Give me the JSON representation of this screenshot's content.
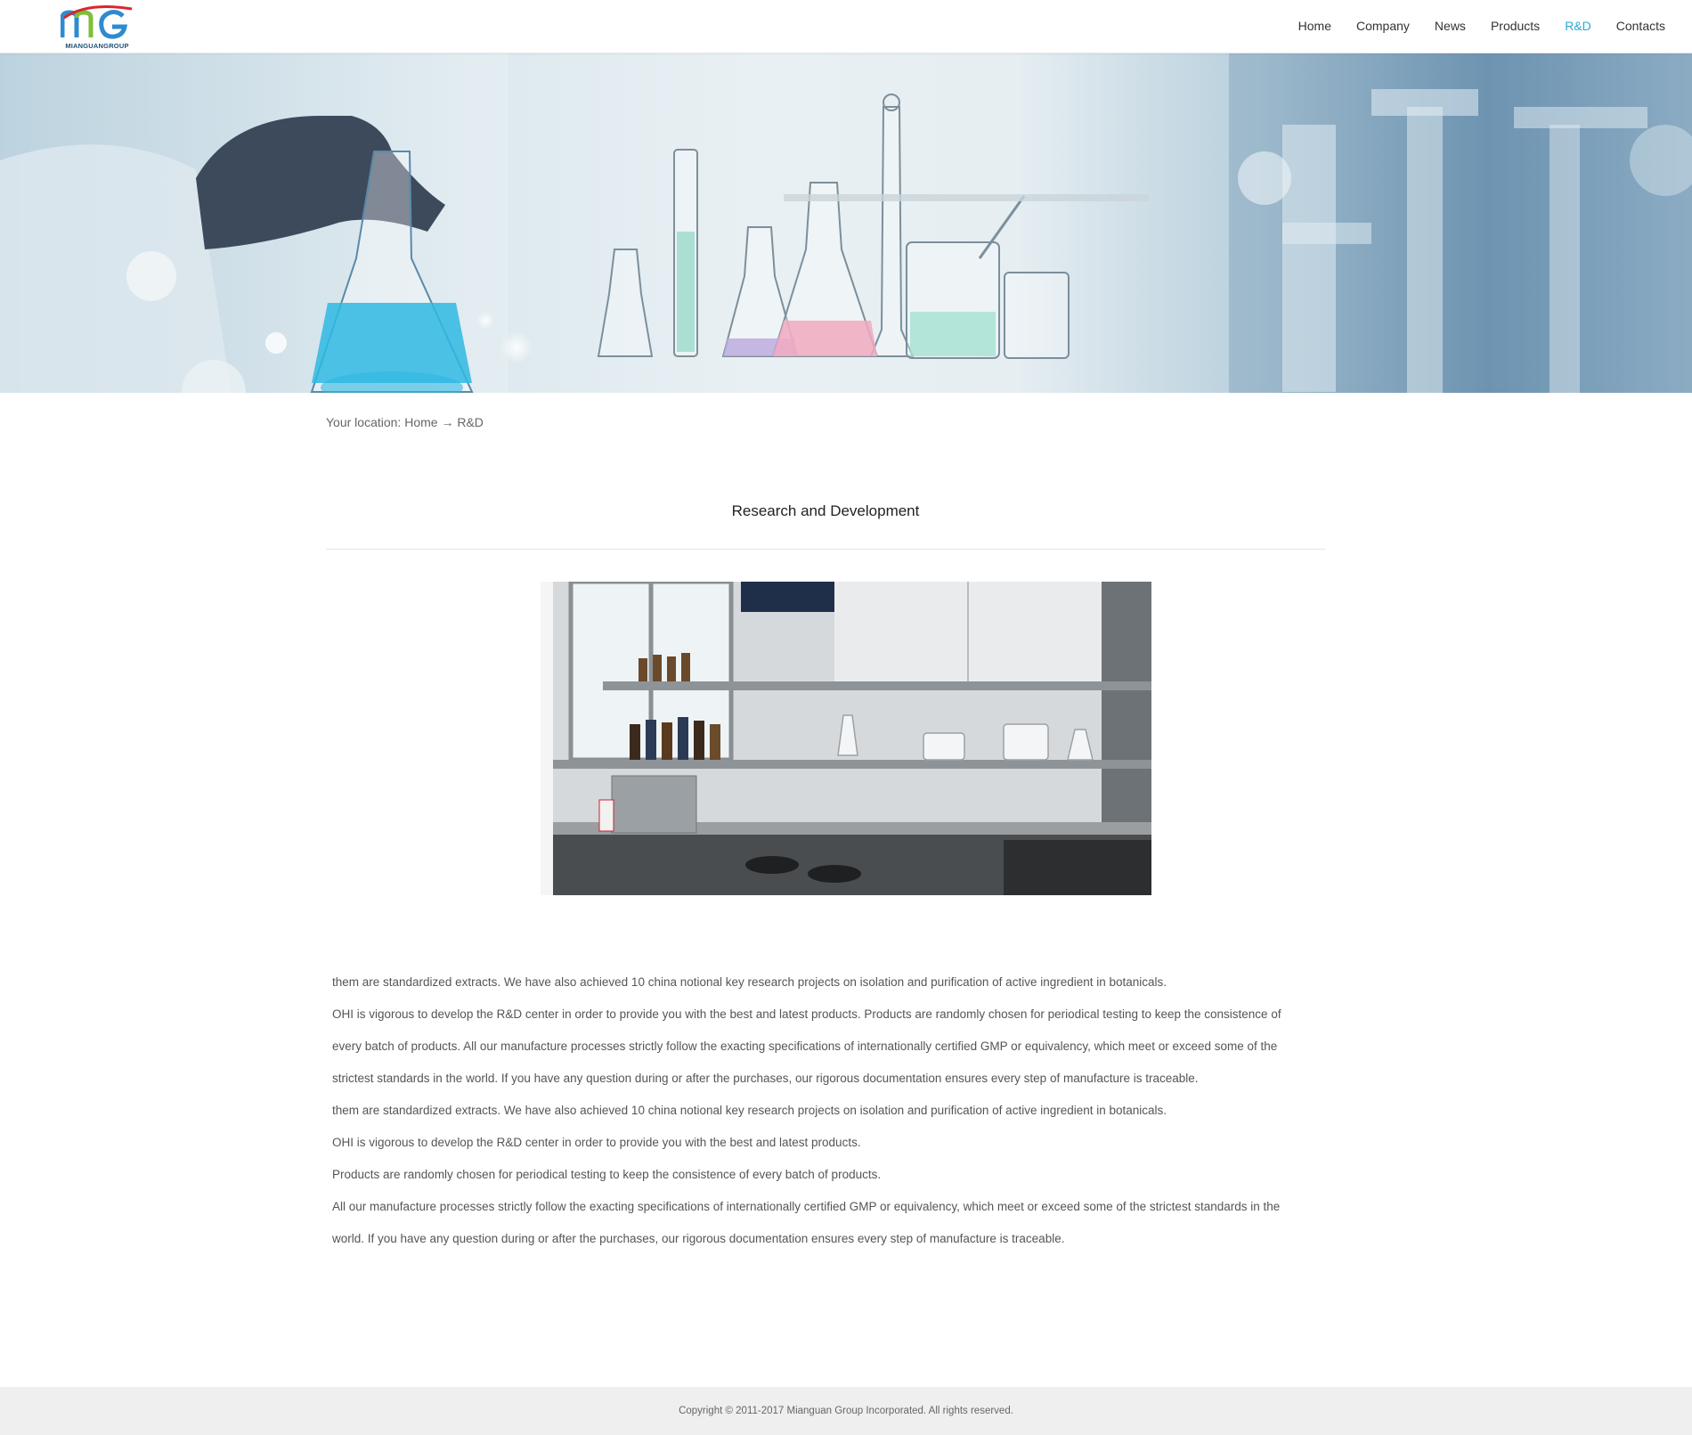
{
  "header": {
    "logo_text": "MIANGUANGROUP",
    "nav": [
      {
        "label": "Home"
      },
      {
        "label": "Company"
      },
      {
        "label": "News"
      },
      {
        "label": "Products"
      },
      {
        "label": "R&D",
        "active": true
      },
      {
        "label": "Contacts"
      }
    ],
    "active_color": "#2ea7d6"
  },
  "breadcrumb": {
    "prefix": "Your location:",
    "home": "Home",
    "separator": "→",
    "current": "R&D"
  },
  "main": {
    "title": "Research and Development",
    "paragraphs": [
      "them are standardized extracts. We have also achieved 10 china notional key research projects on isolation and purification of active ingredient in botanicals.",
      "OHI is vigorous to develop the R&D center in order to provide you with the best and latest products. Products are randomly chosen for periodical testing to keep the consistence of",
      "every batch of products. All our manufacture processes strictly follow the exacting specifications of internationally certified GMP or equivalency, which meet or exceed some of the",
      "strictest standards in the world. If you have any question during or after the purchases, our rigorous documentation ensures every step of manufacture is traceable.",
      "them are standardized extracts. We have also achieved 10 china notional key research projects on isolation and purification of active ingredient in botanicals.",
      "OHI is vigorous to develop the R&D center in order to provide you with the best and latest products.",
      "Products are randomly chosen for periodical testing to keep the consistence of every batch of products.",
      " All our manufacture processes strictly follow the exacting specifications of internationally certified GMP or equivalency, which meet or exceed some of the strictest standards in the",
      "world. If you have any question during or after the purchases, our rigorous documentation ensures every step of manufacture is traceable."
    ]
  },
  "footer": {
    "copyright": "Copyright © 2011-2017 Mianguan Group Incorporated. All rights reserved."
  }
}
